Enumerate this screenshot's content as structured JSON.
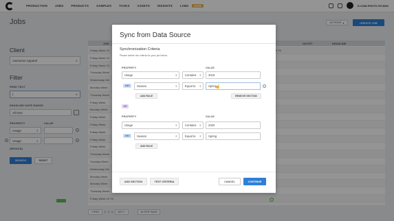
{
  "nav": {
    "links": [
      "PRODUCTION",
      "JOBS",
      "PRODUCTS",
      "SAMPLES",
      "TASKS",
      "ASSETS",
      "INSIGHTS",
      "LABS"
    ],
    "labs_badge": "NEW",
    "studio_name": "E-COM PHOTO STUDIO"
  },
  "header": {
    "title": "Jobs",
    "actions_label": "ACTIONS",
    "create_label": "CREATE JOB"
  },
  "filters": {
    "client_heading": "Client",
    "client_value": "Awesome Apparel",
    "filter_heading": "Filter",
    "free_text_label": "FREE TEXT",
    "free_text_value": "|",
    "deadline_label": "DEADLINE DATE RANGE",
    "deadline_value": "All time",
    "property_label": "PROPERTY",
    "value_label": "VALUE",
    "property1": "Usage",
    "property2": "Usage",
    "or_label": "(REGION)",
    "search_label": "SEARCH",
    "reset_label": "RESET"
  },
  "table": {
    "headers": [
      "JOB",
      "ASKED IN",
      "OUTFIT",
      "DEADLINE"
    ],
    "rows": [
      {
        "job": "Friday Week 19",
        "asked": "Friday Week 19 TS"
      },
      {
        "job": "Friday Week 19",
        "asked": ""
      },
      {
        "job": "Friday Week 19",
        "asked": ""
      },
      {
        "job": "Thursday Week",
        "asked": ""
      },
      {
        "job": "Wednesday We",
        "asked": ""
      },
      {
        "job": "Monday Week",
        "asked": ""
      },
      {
        "job": "Thursday Week",
        "asked": ""
      },
      {
        "job": "Friday Week",
        "asked": ""
      },
      {
        "job": "Monday Week",
        "asked": ""
      },
      {
        "job": "Friday Week",
        "asked": ""
      },
      {
        "job": "Friday Week",
        "asked": ""
      },
      {
        "job": "Friday Week",
        "asked": ""
      },
      {
        "job": "Friday Week",
        "asked": ""
      },
      {
        "job": "Friday Week",
        "asked": ""
      },
      {
        "job": "Thursday Week",
        "asked": ""
      },
      {
        "job": "Tuesday Week",
        "asked": ""
      },
      {
        "job": "Wednesday We",
        "asked": ""
      },
      {
        "job": "Monday Week",
        "asked": ""
      },
      {
        "job": "Monday Week",
        "asked": ""
      },
      {
        "job": "Thursday Week",
        "asked": ""
      },
      {
        "job": "Friday Week 19 TS",
        "asked": ""
      }
    ],
    "pager": {
      "prev": "‹ PREV",
      "pages": [
        "1",
        "2",
        "3"
      ],
      "next": "NEXT ›",
      "per_page": "50 PER PAGE"
    }
  },
  "modal": {
    "title": "Sync from Data Source",
    "subtitle": "Synchronization Criteria",
    "help": "Please define the criteria for your job below.",
    "property_label": "PROPERTY",
    "value_label": "VALUE",
    "section1": {
      "row1": {
        "property": "Usage",
        "op": "Contains",
        "value": "2019"
      },
      "row2": {
        "tag": "AND",
        "property": "Season",
        "op": "Equal to",
        "value": "Spring"
      },
      "add_rule": "ADD RULE",
      "remove_section": "REMOVE SECTION"
    },
    "or_tag": "OR",
    "section2": {
      "row1": {
        "property": "Usage",
        "op": "Contains",
        "value": "2020"
      },
      "row2": {
        "tag": "AND",
        "property": "Season",
        "op": "Equal to",
        "value": "Spring"
      },
      "add_rule": "ADD RULE"
    },
    "add_section": "ADD SECTION",
    "test_criteria": "TEST CRITERIA",
    "cancel": "CANCEL",
    "continue": "CONTINUE"
  }
}
